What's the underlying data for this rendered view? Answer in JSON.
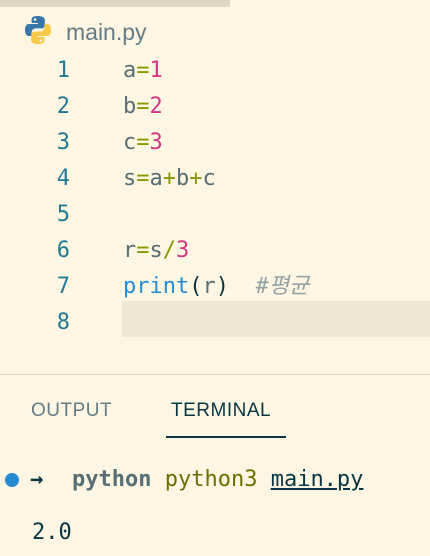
{
  "tab": {
    "filename": "main.py",
    "icon": "python-icon"
  },
  "editor": {
    "lines": [
      {
        "num": "1",
        "tokens": [
          {
            "t": "a",
            "k": "var"
          },
          {
            "t": "=",
            "k": "op"
          },
          {
            "t": "1",
            "k": "num"
          }
        ]
      },
      {
        "num": "2",
        "tokens": [
          {
            "t": "b",
            "k": "var"
          },
          {
            "t": "=",
            "k": "op"
          },
          {
            "t": "2",
            "k": "num"
          }
        ]
      },
      {
        "num": "3",
        "tokens": [
          {
            "t": "c",
            "k": "var"
          },
          {
            "t": "=",
            "k": "op"
          },
          {
            "t": "3",
            "k": "num"
          }
        ]
      },
      {
        "num": "4",
        "tokens": [
          {
            "t": "s",
            "k": "var"
          },
          {
            "t": "=",
            "k": "op"
          },
          {
            "t": "a",
            "k": "var"
          },
          {
            "t": "+",
            "k": "op"
          },
          {
            "t": "b",
            "k": "var"
          },
          {
            "t": "+",
            "k": "op"
          },
          {
            "t": "c",
            "k": "var"
          }
        ]
      },
      {
        "num": "5",
        "tokens": []
      },
      {
        "num": "6",
        "tokens": [
          {
            "t": "r",
            "k": "var"
          },
          {
            "t": "=",
            "k": "op"
          },
          {
            "t": "s",
            "k": "var"
          },
          {
            "t": "/",
            "k": "op"
          },
          {
            "t": "3",
            "k": "num"
          }
        ]
      },
      {
        "num": "7",
        "tokens": [
          {
            "t": "print",
            "k": "fn"
          },
          {
            "t": "(",
            "k": "paren"
          },
          {
            "t": "r",
            "k": "var"
          },
          {
            "t": ")",
            "k": "paren"
          },
          {
            "t": "  ",
            "k": "var"
          },
          {
            "t": "#평균",
            "k": "cm"
          }
        ]
      },
      {
        "num": "8",
        "tokens": []
      }
    ]
  },
  "panel": {
    "tabs": {
      "output": "OUTPUT",
      "terminal": "TERMINAL"
    },
    "terminal": {
      "prompt_arrow": "→",
      "cmd_part1": "python",
      "cmd_part2": "python3",
      "cmd_part3": "main.py",
      "output": "2.0"
    }
  },
  "colors": {
    "background": "#fdf6e3",
    "line_number": "#237893",
    "operator": "#859900",
    "number": "#d33682",
    "function": "#268bd2",
    "comment": "#93a1a1",
    "status_dot": "#268bd2"
  }
}
